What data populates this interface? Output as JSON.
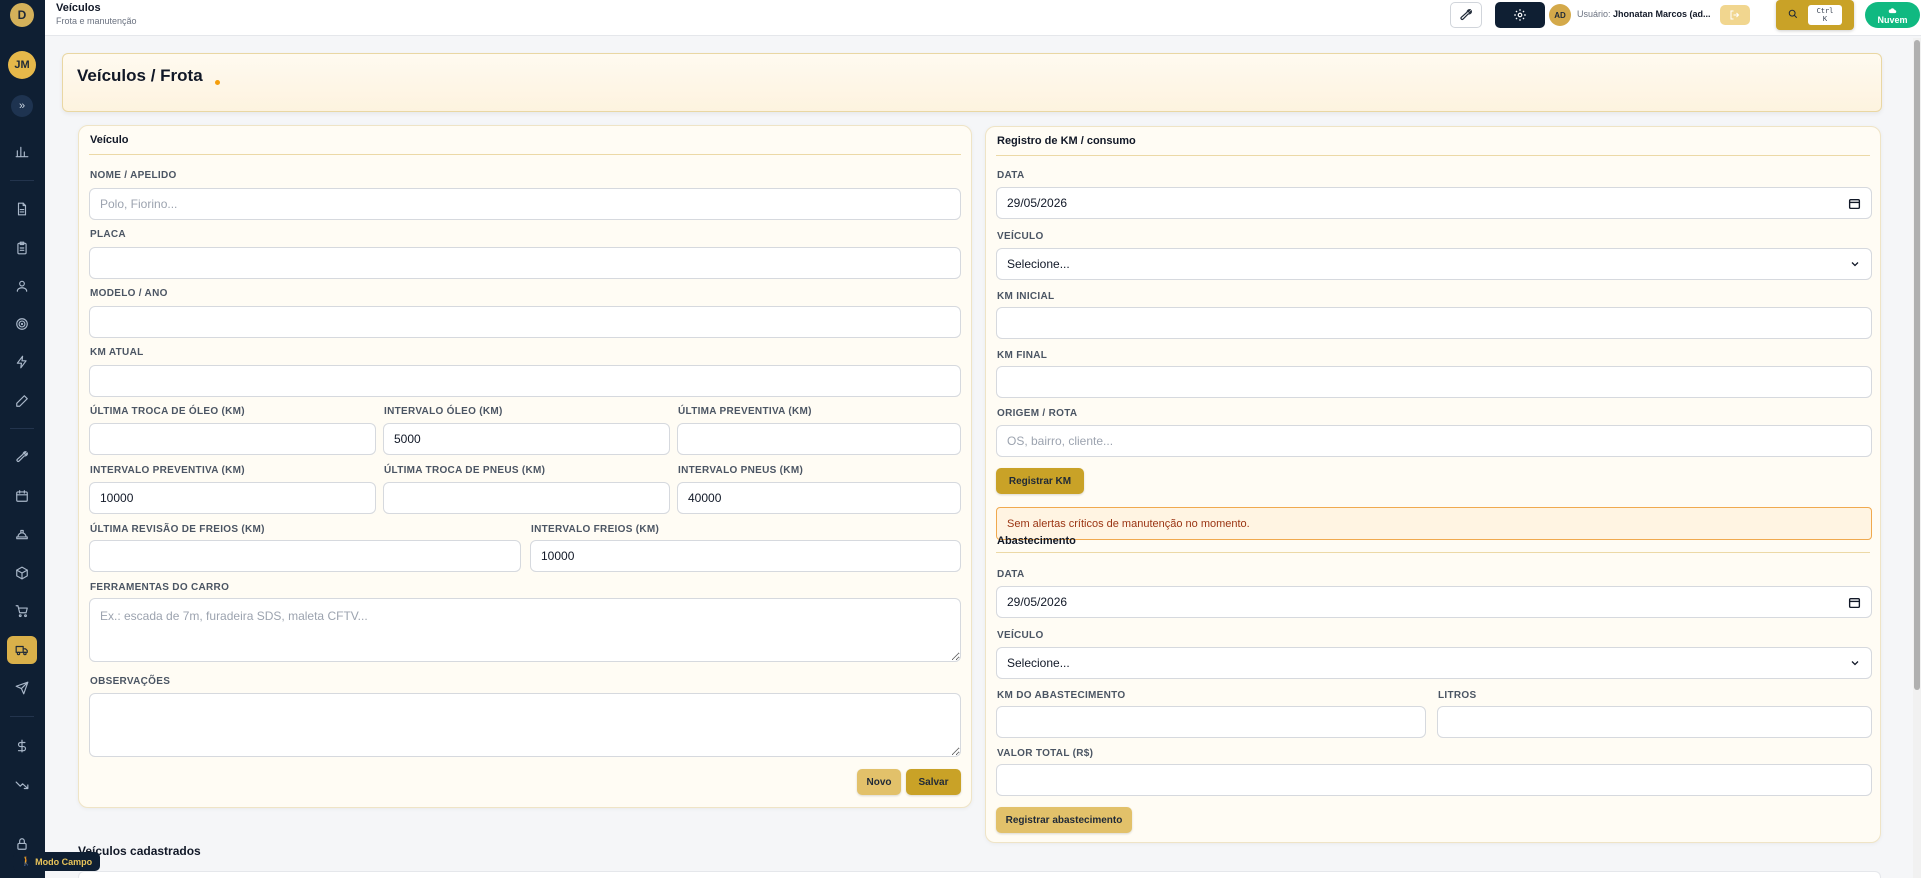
{
  "app": {
    "logo_letter": "D",
    "page_title": "Veículos",
    "page_subtitle": "Frota e manutenção"
  },
  "sidebar": {
    "avatar": "JM",
    "toggle": "»",
    "items": [
      {
        "icon": "bar-chart-icon"
      },
      {
        "icon": "document-icon"
      },
      {
        "icon": "clipboard-icon"
      },
      {
        "icon": "user-icon"
      },
      {
        "icon": "target-icon"
      },
      {
        "icon": "lightning-icon"
      },
      {
        "icon": "pencil-icon"
      },
      {
        "icon": "wrench-icon"
      },
      {
        "icon": "calendar-icon"
      },
      {
        "icon": "hard-hat-icon"
      },
      {
        "icon": "box-icon"
      },
      {
        "icon": "cart-icon"
      },
      {
        "icon": "truck-icon",
        "active": true
      },
      {
        "icon": "send-icon"
      },
      {
        "icon": "dollar-icon"
      },
      {
        "icon": "trend-down-icon"
      },
      {
        "icon": "lock-icon"
      }
    ],
    "field_mode": "Modo Campo"
  },
  "topbar": {
    "avatar": "AD",
    "user_label": "Usuário:",
    "user_name": "Jhonatan Marcos (ad...",
    "kbd_line1": "Ctrl",
    "kbd_line2": "K",
    "cloud_label": "Nuvem"
  },
  "header": {
    "title": "Veículos / Frota"
  },
  "vehicle": {
    "title": "Veículo",
    "name_label": "NOME / APELIDO",
    "name_placeholder": "Polo, Fiorino...",
    "plate_label": "PLACA",
    "model_label": "MODELO / ANO",
    "km_label": "KM ATUAL",
    "oil_last_label": "ÚLTIMA TROCA DE ÓLEO (KM)",
    "oil_interval_label": "INTERVALO ÓLEO (KM)",
    "oil_interval_value": "5000",
    "prev_last_label": "ÚLTIMA PREVENTIVA (KM)",
    "prev_interval_label": "INTERVALO PREVENTIVA (KM)",
    "prev_interval_value": "10000",
    "tires_last_label": "ÚLTIMA TROCA DE PNEUS (KM)",
    "tires_interval_label": "INTERVALO PNEUS (KM)",
    "tires_interval_value": "40000",
    "brakes_last_label": "ÚLTIMA REVISÃO DE FREIOS (KM)",
    "brakes_interval_label": "INTERVALO FREIOS (KM)",
    "brakes_interval_value": "10000",
    "tools_label": "FERRAMENTAS DO CARRO",
    "tools_placeholder": "Ex.: escada de 7m, furadeira SDS, maleta CFTV...",
    "notes_label": "OBSERVAÇÕES",
    "new_button": "Novo",
    "save_button": "Salvar"
  },
  "km_log": {
    "title": "Registro de KM / consumo",
    "date_label": "DATA",
    "date_value": "29/05/2026",
    "vehicle_label": "VEÍCULO",
    "vehicle_value": "Selecione...",
    "km_start_label": "KM INICIAL",
    "km_end_label": "KM FINAL",
    "origin_label": "ORIGEM / ROTA",
    "origin_placeholder": "OS, bairro, cliente...",
    "register_button": "Registrar KM",
    "alert": "Sem alertas críticos de manutenção no momento."
  },
  "fuel": {
    "title": "Abastecimento",
    "date_label": "DATA",
    "date_value": "29/05/2026",
    "vehicle_label": "VEÍCULO",
    "vehicle_value": "Selecione...",
    "km_label": "KM DO ABASTECIMENTO",
    "liters_label": "LITROS",
    "total_label": "VALOR TOTAL (R$)",
    "register_button": "Registrar abastecimento"
  },
  "list": {
    "title": "Veículos cadastrados"
  }
}
